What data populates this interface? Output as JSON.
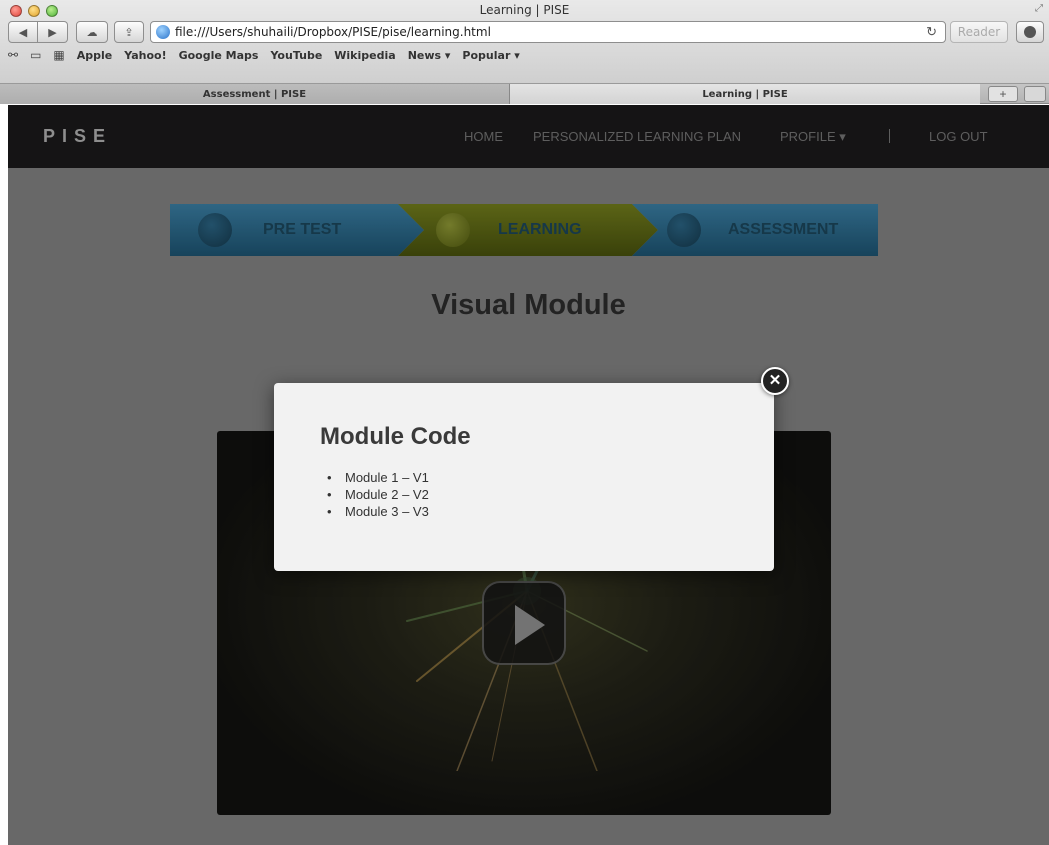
{
  "window": {
    "title": "Learning | PISE",
    "url": "file:///Users/shuhaili/Dropbox/PISE/pise/learning.html",
    "reader_label": "Reader"
  },
  "bookmarks": [
    "Apple",
    "Yahoo!",
    "Google Maps",
    "YouTube",
    "Wikipedia",
    "News ▾",
    "Popular ▾"
  ],
  "tabs": [
    {
      "label": "Assessment | PISE",
      "active": false
    },
    {
      "label": "Learning | PISE",
      "active": true
    }
  ],
  "site": {
    "brand": "PISE",
    "nav": [
      "HOME",
      "PERSONALIZED LEARNING PLAN",
      "PROFILE ▾",
      "LOG OUT"
    ]
  },
  "steps": [
    {
      "label": "PRE TEST",
      "color": "#2f6d8f"
    },
    {
      "label": "LEARNING",
      "color": "#5f6a14"
    },
    {
      "label": "ASSESSMENT",
      "color": "#2f6d8f"
    }
  ],
  "page_title": "Visual Module",
  "modal": {
    "title": "Module Code",
    "items": [
      "Module 1 – V1",
      "Module 2 – V2",
      "Module 3 – V3"
    ]
  },
  "icons": {
    "close": "close-icon",
    "play": "play-icon"
  }
}
